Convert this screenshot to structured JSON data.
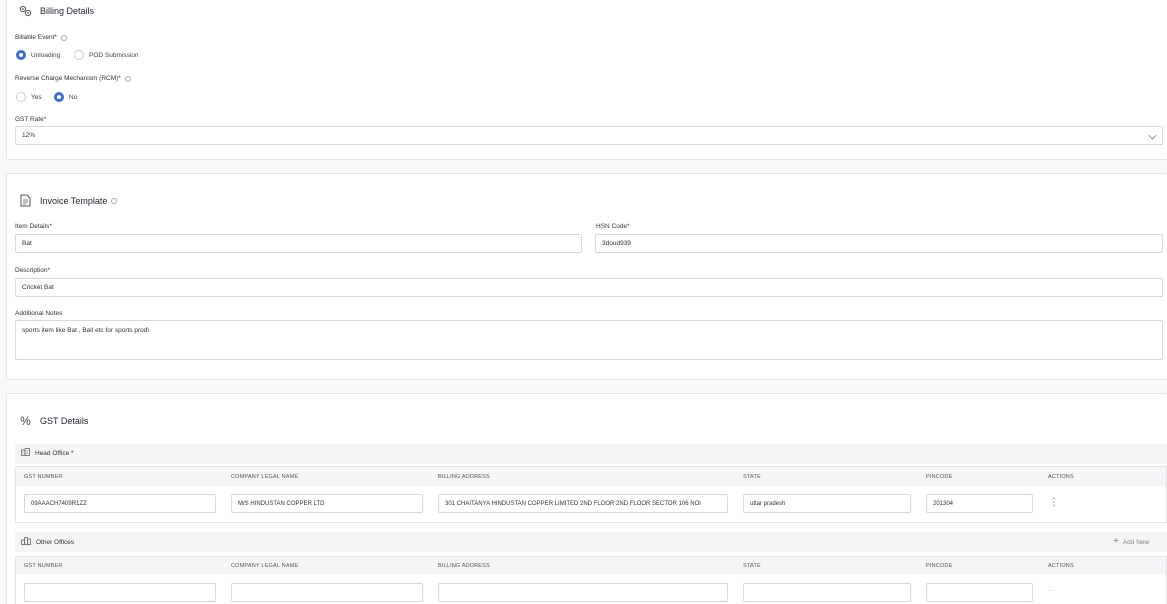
{
  "billing": {
    "title": "Billing Details",
    "billable_event_label": "Billable Event*",
    "billable_options": [
      "Unloading",
      "POD Submission"
    ],
    "rcm_label": "Reverse Charge Mechanism (RCM)*",
    "rcm_options": [
      "Yes",
      "No"
    ],
    "gst_rate_label": "GST Rate*",
    "gst_rate_value": "12%"
  },
  "invoice": {
    "title": "Invoice Template",
    "item_details_label": "Item Details*",
    "item_details_value": "Bat",
    "hsn_label": "HSN Code*",
    "hsn_value": "3doud939",
    "description_label": "Description*",
    "description_value": "Cricket Bat",
    "notes_label": "Additional Notes",
    "notes_value": "sports item like  Bat , Ball  etc for sports prod\\"
  },
  "gst": {
    "title": "GST Details",
    "head_office_label": "Head Office *",
    "other_offices_label": "Other Offices",
    "add_new_label": "Add New",
    "columns": [
      "GST NUMBER",
      "COMPANY LEGAL NAME",
      "BILLING ADDRESS",
      "STATE",
      "PINCODE",
      "ACTIONS"
    ],
    "head_row": {
      "gst_number": "09AAACH7409R1ZZ",
      "company": "M/S HINDUSTAN COPPER LTD",
      "address": "301 CHAITANYA HINDUSTAN COPPER LIMITED 2ND FLOOR 2ND FLOOR SECTOR 106 NOI",
      "state": "uttar pradesh",
      "pincode": "201304"
    },
    "other_actions_placeholder": "..."
  },
  "colors": {
    "accent": "#3e6bd6",
    "border": "#d6d8dd"
  }
}
